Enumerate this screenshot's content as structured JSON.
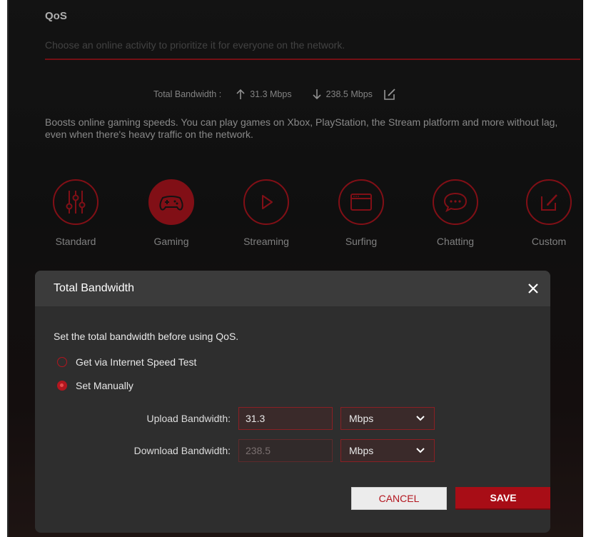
{
  "page": {
    "title": "QoS",
    "subtitle": "Choose an online activity to prioritize it for everyone on the network.",
    "accent_color": "#b3161f"
  },
  "bandwidth_summary": {
    "label": "Total Bandwidth :",
    "upload": "31.3 Mbps",
    "download": "238.5 Mbps",
    "upload_icon": "arrow-up-icon",
    "download_icon": "arrow-down-icon",
    "edit_icon": "edit-icon"
  },
  "description": "Boosts online gaming speeds. You can play games on Xbox, PlayStation, the Stream platform and more without lag, even when there's heavy traffic on the network.",
  "modes": [
    {
      "label": "Standard",
      "icon": "sliders-icon",
      "active": false
    },
    {
      "label": "Gaming",
      "icon": "gamepad-icon",
      "active": true
    },
    {
      "label": "Streaming",
      "icon": "play-icon",
      "active": false
    },
    {
      "label": "Surfing",
      "icon": "browser-icon",
      "active": false
    },
    {
      "label": "Chatting",
      "icon": "chat-bubble-icon",
      "active": false
    },
    {
      "label": "Custom",
      "icon": "edit-icon",
      "active": false
    }
  ],
  "dialog": {
    "title": "Total Bandwidth",
    "close_icon": "close-icon",
    "intro": "Set the total bandwidth before using QoS.",
    "options": [
      {
        "label": "Get via Internet Speed Test",
        "checked": false
      },
      {
        "label": "Set Manually",
        "checked": true
      }
    ],
    "upload": {
      "label": "Upload Bandwidth:",
      "value": "31.3",
      "unit": "Mbps"
    },
    "download": {
      "label": "Download Bandwidth:",
      "value": "238.5",
      "unit": "Mbps"
    },
    "cancel_label": "CANCEL",
    "save_label": "SAVE"
  }
}
